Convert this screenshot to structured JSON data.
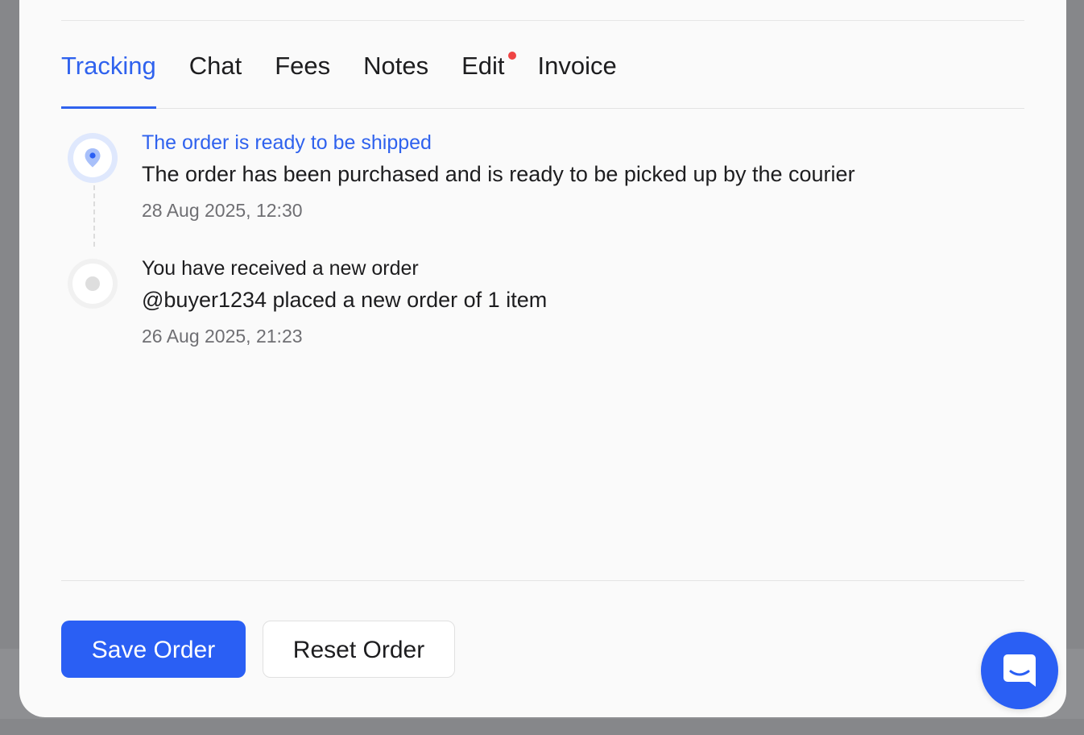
{
  "tabs": [
    {
      "label": "Tracking",
      "active": true,
      "has_badge": false
    },
    {
      "label": "Chat",
      "active": false,
      "has_badge": false
    },
    {
      "label": "Fees",
      "active": false,
      "has_badge": false
    },
    {
      "label": "Notes",
      "active": false,
      "has_badge": false
    },
    {
      "label": "Edit",
      "active": false,
      "has_badge": true
    },
    {
      "label": "Invoice",
      "active": false,
      "has_badge": false
    }
  ],
  "timeline": [
    {
      "title": "The order is ready to be shipped",
      "description": "The order has been purchased and is ready to be picked up by the courier",
      "timestamp": "28 Aug 2025, 12:30",
      "icon": "map-pin-icon",
      "active": true
    },
    {
      "title": "You have received a new order",
      "description": "@buyer1234 placed a new order of 1 item",
      "timestamp": "26 Aug 2025, 21:23",
      "icon": "dot-icon",
      "active": false
    }
  ],
  "actions": {
    "save_label": "Save Order",
    "reset_label": "Reset Order"
  },
  "chat_launcher": {
    "icon": "chat-bubble-icon"
  },
  "colors": {
    "accent": "#2a5ff4",
    "badge": "#ef4444",
    "text": "#1d1d1f",
    "muted": "#6f6f73",
    "backdrop": "#86878a"
  }
}
